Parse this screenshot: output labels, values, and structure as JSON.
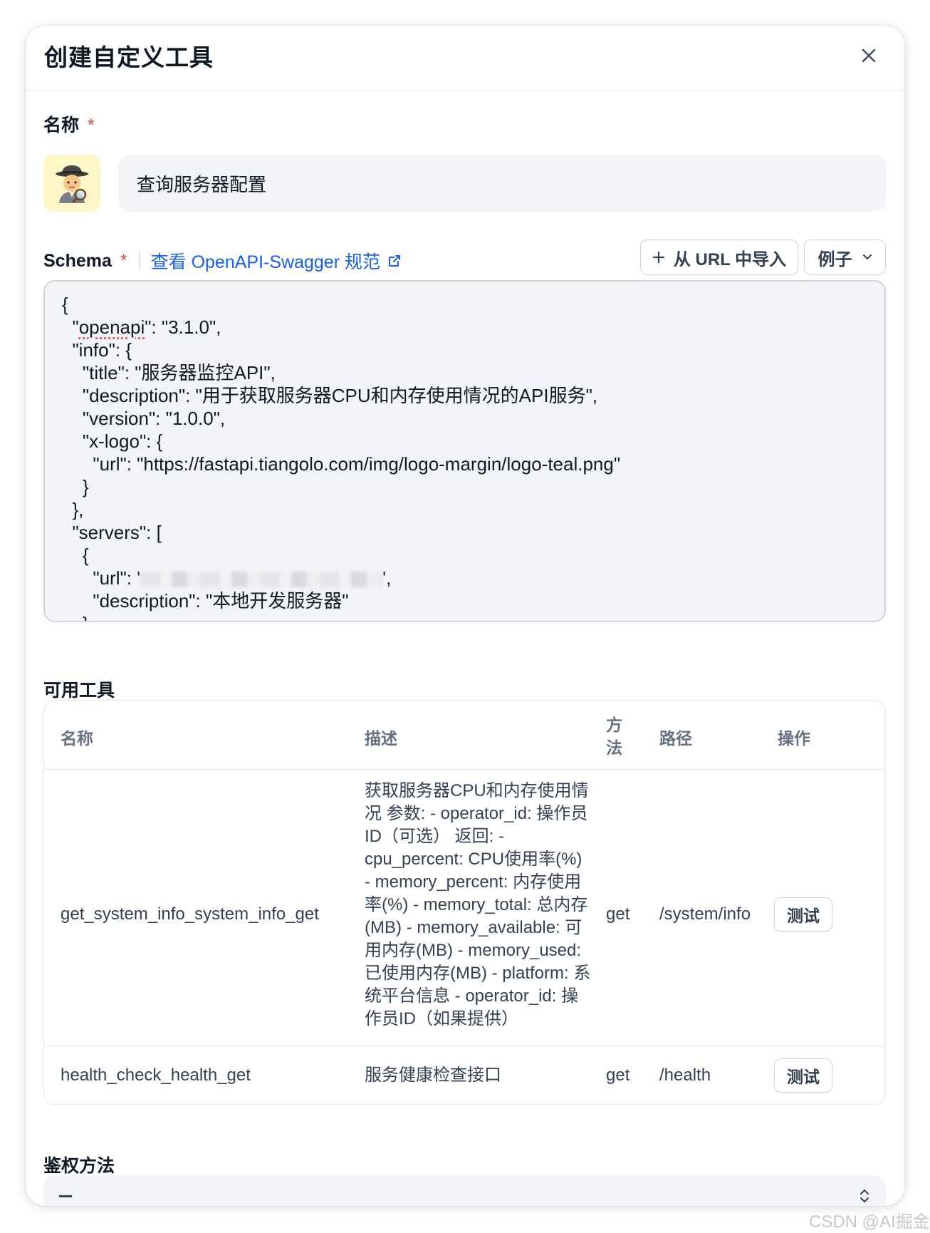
{
  "dialog": {
    "title": "创建自定义工具"
  },
  "name_section": {
    "label": "名称",
    "required_mark": "*",
    "avatar_icon": "detective-emoji",
    "value": "查询服务器配置"
  },
  "schema_section": {
    "label": "Schema",
    "required_mark": "*",
    "doc_link": "查看 OpenAPI-Swagger 规范",
    "import_button": "从 URL 中导入",
    "example_button": "例子",
    "code_lines": [
      "{",
      "  \"openapi\": \"3.1.0\",",
      "  \"info\": {",
      "    \"title\": \"服务器监控API\",",
      "    \"description\": \"用于获取服务器CPU和内存使用情况的API服务\",",
      "    \"version\": \"1.0.0\",",
      "    \"x-logo\": {",
      "      \"url\": \"https://fastapi.tiangolo.com/img/logo-margin/logo-teal.png\"",
      "    }",
      "  },",
      "  \"servers\": [",
      "    {",
      "      \"url\": \"",
      "      \"description\": \"本地开发服务器\"",
      "    }"
    ],
    "code_line_0": "{",
    "code_line_1_key": "openapi",
    "code_line_1_rest": "\": \"3.1.0\",",
    "code_line_2": "  \"info\": {",
    "code_line_3": "    \"title\": \"服务器监控API\",",
    "code_line_4": "    \"description\": \"用于获取服务器CPU和内存使用情况的API服务\",",
    "code_line_5": "    \"version\": \"1.0.0\",",
    "code_line_6": "    \"x-logo\": {",
    "code_line_7": "      \"url\": \"https://fastapi.tiangolo.com/img/logo-margin/logo-teal.png\"",
    "code_line_8": "    }",
    "code_line_9": "  },",
    "code_line_10": "  \"servers\": [",
    "code_line_11": "    {",
    "code_line_12_pre": "      \"url\": '",
    "code_line_12_post": "',",
    "code_line_13": "      \"description\": \"本地开发服务器\"",
    "code_line_14": "    }"
  },
  "tools_section": {
    "label": "可用工具",
    "columns": [
      "名称",
      "描述",
      "方法",
      "路径",
      "操作"
    ],
    "method_header_line1": "方",
    "method_header_line2": "法",
    "rows": [
      {
        "name": "get_system_info_system_info_get",
        "description_lines": [
          "获取服务器CPU和内存使用情",
          "况 参数: - operator_id: 操作员",
          "ID（可选） 返回: -",
          "cpu_percent: CPU使用率(%)",
          "- memory_percent: 内存使用",
          "率(%) - memory_total: 总内存",
          "(MB) - memory_available: 可",
          "用内存(MB) - memory_used:",
          "已使用内存(MB) - platform: 系",
          "统平台信息 - operator_id: 操",
          "作员ID（如果提供）"
        ],
        "method": "get",
        "path": "/system/info",
        "action": "测试"
      },
      {
        "name": "health_check_health_get",
        "description": "服务健康检查接口",
        "method": "get",
        "path": "/health",
        "action": "测试"
      }
    ]
  },
  "auth_section": {
    "label": "鉴权方法"
  },
  "watermark": "CSDN @AI掘金"
}
